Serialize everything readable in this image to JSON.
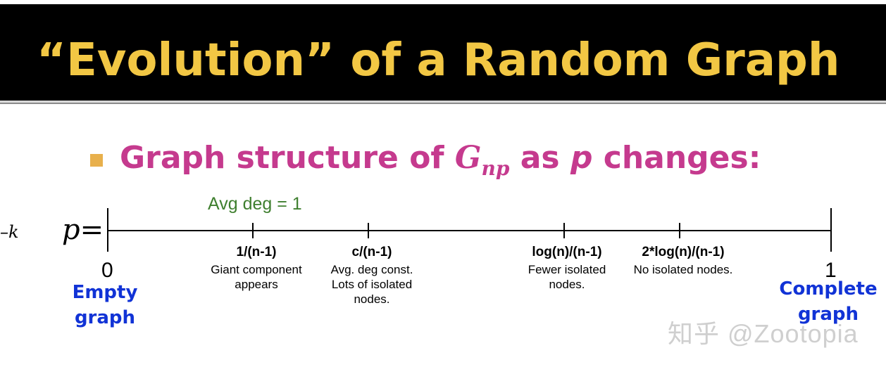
{
  "slide": {
    "title": "“Evolution” of a Random Graph",
    "heading": {
      "pre": "Graph structure of ",
      "g": "G",
      "sub": "np",
      "mid": " as ",
      "p": "p",
      "post": " changes:"
    },
    "k_fragment": "–k",
    "p_label": "p=",
    "avg_deg": "Avg deg = 1"
  },
  "axis_points": [
    {
      "title": "1/(n-1)",
      "desc": "Giant component\nappears"
    },
    {
      "title": "c/(n-1)",
      "desc": "Avg. deg const.\nLots of isolated\nnodes."
    },
    {
      "title": "log(n)/(n-1)",
      "desc": "Fewer isolated\nnodes."
    },
    {
      "title": "2*log(n)/(n-1)",
      "desc": "No isolated nodes."
    }
  ],
  "ends": {
    "left": {
      "num": "0",
      "label": "Empty\ngraph"
    },
    "right": {
      "num": "1",
      "label": "Complete\ngraph"
    }
  },
  "watermark": "知乎 @Zootopia",
  "colors": {
    "title": "#f2c744",
    "heading": "#c53a8e",
    "avg_deg": "#3f7f2f",
    "end_labels": "#1133d6"
  }
}
